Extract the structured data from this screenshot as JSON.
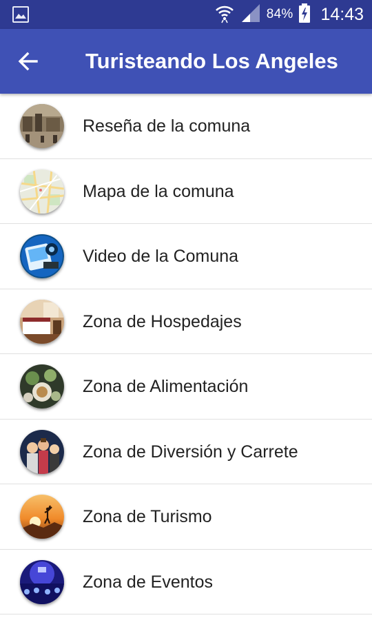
{
  "status_bar": {
    "battery_percent": "84%",
    "time": "14:43",
    "icons": [
      "gallery-notification-icon",
      "wifi-icon",
      "signal-icon",
      "battery-charging-icon"
    ]
  },
  "app_bar": {
    "title": "Turisteando Los Angeles",
    "back_icon": "arrow-back-icon",
    "background_color": "#3f51b5",
    "status_color": "#2e3a92"
  },
  "menu": {
    "items": [
      {
        "label": "Reseña de la comuna",
        "icon": "history-photo-thumbnail"
      },
      {
        "label": "Mapa de la comuna",
        "icon": "map-thumbnail"
      },
      {
        "label": "Video de la Comuna",
        "icon": "video-thumbnail"
      },
      {
        "label": "Zona de Hospedajes",
        "icon": "hotel-room-thumbnail"
      },
      {
        "label": "Zona de Alimentación",
        "icon": "food-thumbnail"
      },
      {
        "label": "Zona de Diversión y Carrete",
        "icon": "party-thumbnail"
      },
      {
        "label": "Zona de Turismo",
        "icon": "sunset-tourism-thumbnail"
      },
      {
        "label": "Zona de Eventos",
        "icon": "events-thumbnail"
      }
    ]
  }
}
